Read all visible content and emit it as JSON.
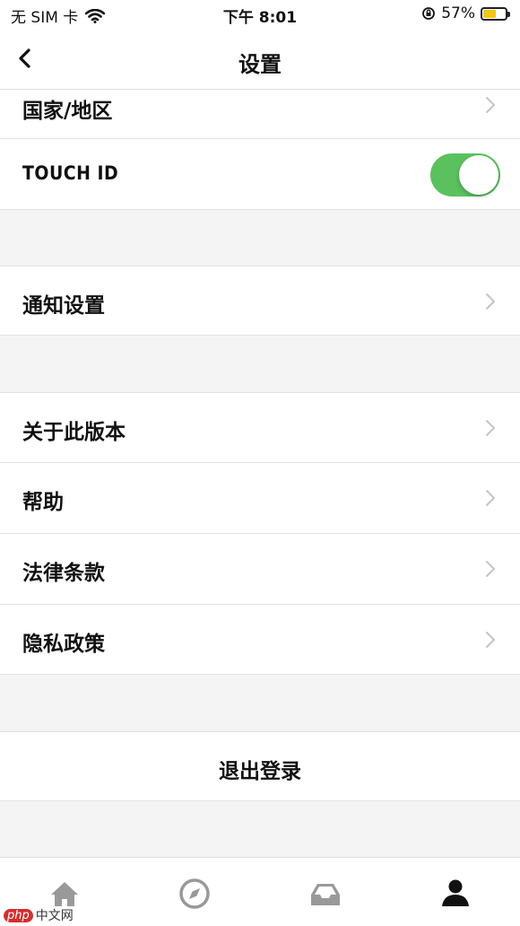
{
  "status_bar": {
    "carrier": "无 SIM 卡",
    "time": "下午 8:01",
    "battery_percent": "57%",
    "battery_level": 0.57,
    "battery_color": "#f5c518"
  },
  "nav": {
    "title": "设置",
    "back_icon": "chevron-left-icon"
  },
  "rows": {
    "region": "国家/地区",
    "touch_id": "TOUCH ID",
    "touch_id_enabled": true,
    "notifications": "通知设置",
    "about": "关于此版本",
    "help": "帮助",
    "legal": "法律条款",
    "privacy": "隐私政策",
    "logout": "退出登录"
  },
  "colors": {
    "toggle_on": "#5ac15e"
  },
  "tab_bar": {
    "items": [
      "home-icon",
      "compass-icon",
      "inbox-icon",
      "profile-icon"
    ],
    "active": "profile-icon"
  },
  "watermark": {
    "badge": "php",
    "text": "中文网"
  }
}
